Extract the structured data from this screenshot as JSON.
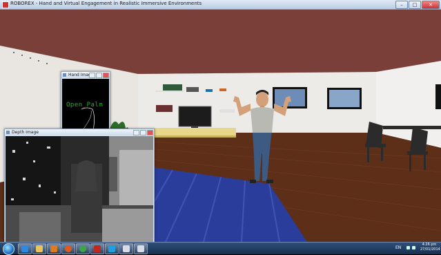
{
  "window": {
    "title": "ROBOREX - Hand and Virtual Engagement in Realistic Immersive Environments",
    "minimize": "–",
    "maximize": "□",
    "close": "✕"
  },
  "hand_window": {
    "title": "Hand Image",
    "gesture": "Open_Palm"
  },
  "depth_window": {
    "title": "Depth Image"
  },
  "taskbar": {
    "apps": [
      "start-orb",
      "internet-explorer-icon",
      "file-explorer-icon",
      "media-player-icon",
      "firefox-icon",
      "chrome-icon",
      "filezilla-icon",
      "skype-icon",
      "app-window-icon",
      "app-window-icon"
    ],
    "language": "EN",
    "time": "4:26 pm",
    "date": "27/01/2014"
  },
  "colors": {
    "wall": "#e9e6e1",
    "ceiling": "#7b3f3a",
    "floor": "#5a2c18",
    "rug": "#2a3d9a",
    "gesture_text": "#1fb81f"
  }
}
